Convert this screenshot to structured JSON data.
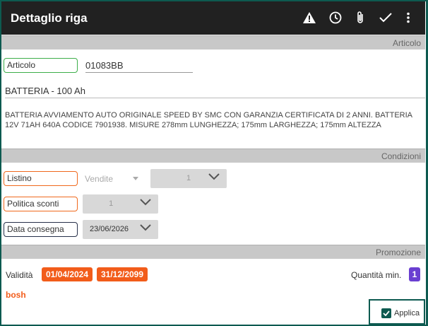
{
  "appbar": {
    "title": "Dettaglio riga",
    "icons": [
      "warning-icon",
      "clock-icon",
      "paperclip-icon",
      "check-icon",
      "more-vert-icon"
    ]
  },
  "articolo": {
    "section_title": "Articolo",
    "field_label": "Articolo",
    "code": "01083BB",
    "name": "BATTERIA - 100 Ah",
    "description": "BATTERIA AVVIAMENTO AUTO ORIGINALE SPEED BY SMC CON GARANZIA CERTIFICATA DI 2 ANNI. BATTERIA 12V 71AH 640A CODICE 7901938. MISURE 278mm LUNGHEZZA; 175mm LARGHEZZA; 175mm ALTEZZA"
  },
  "condizioni": {
    "section_title": "Condizioni",
    "listino_label": "Listino",
    "listino_value": "Vendite",
    "listino_number": "1",
    "politica_label": "Politica sconti",
    "politica_value": "1",
    "data_label": "Data consegna",
    "data_value": "23/06/2026"
  },
  "promozione": {
    "section_title": "Promozione",
    "validita_label": "Validità",
    "date_from": "01/04/2024",
    "date_to": "31/12/2099",
    "qty_label": "Quantità min.",
    "qty_value": "1",
    "brand": "bosh",
    "applica_label": "Applica",
    "applica_checked": true
  },
  "colors": {
    "appbar": "#212121",
    "accent_orange": "#f25c1a",
    "accent_green": "#3dae4a",
    "qty_badge": "#6a3fd1",
    "frame": "#0d5a50"
  }
}
